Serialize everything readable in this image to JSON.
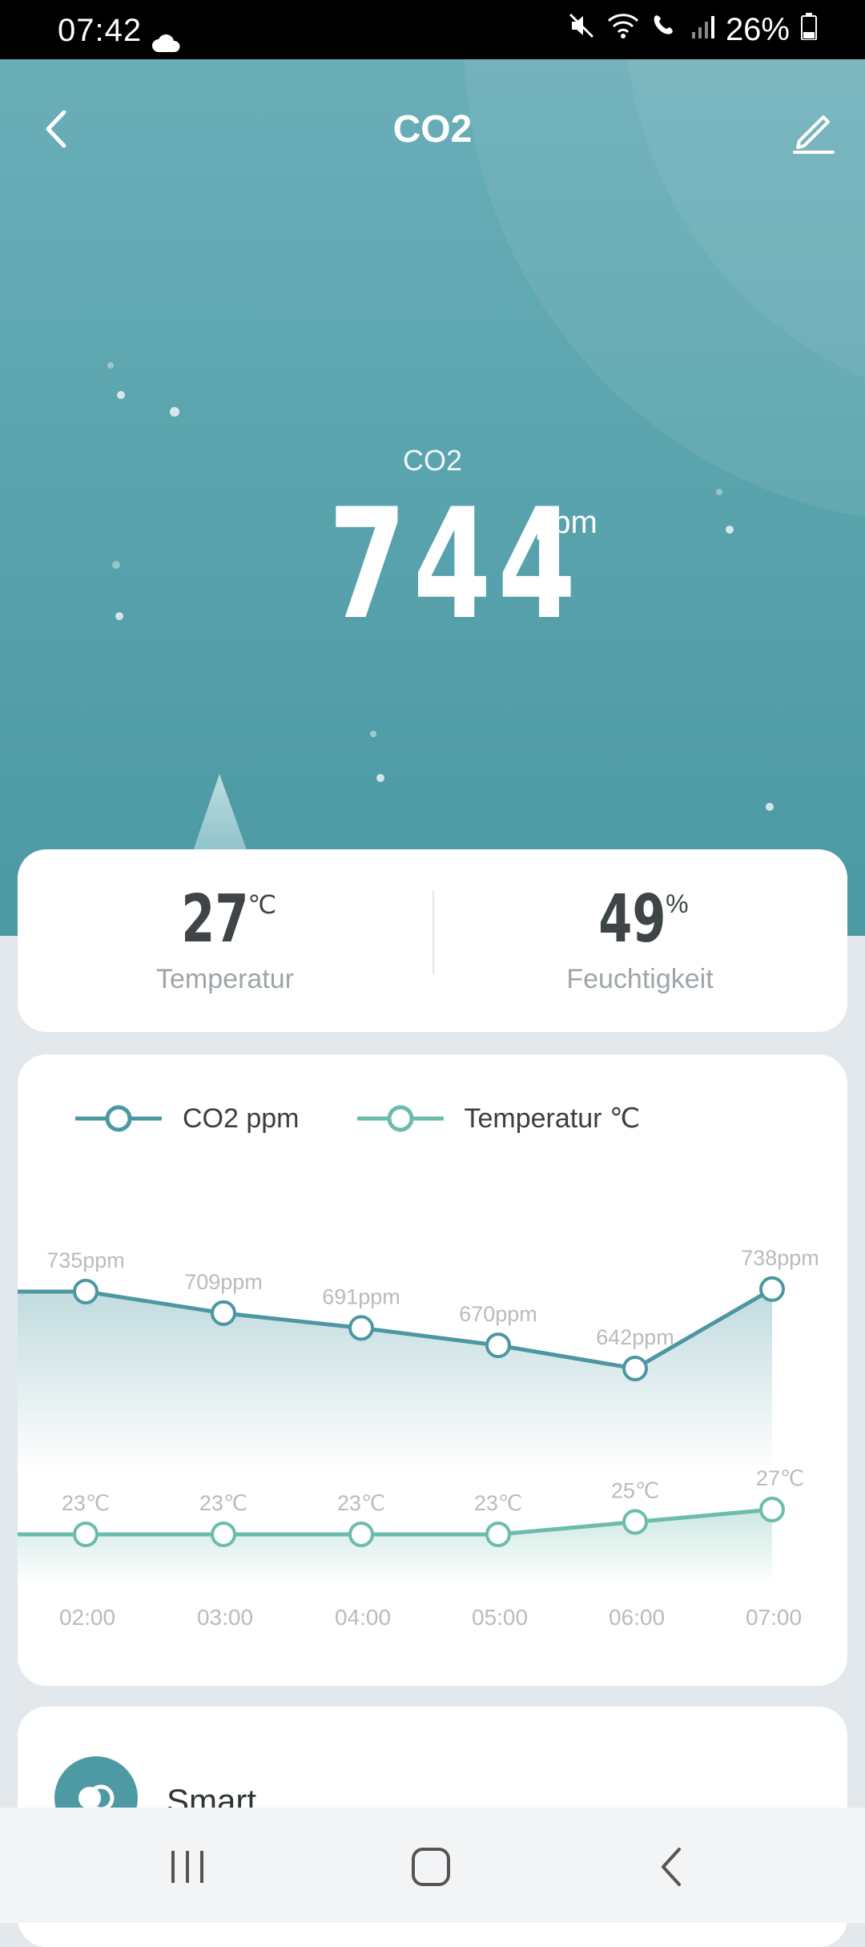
{
  "status_bar": {
    "time": "07:42",
    "battery": "26%"
  },
  "header": {
    "title": "CO2"
  },
  "hero": {
    "label": "CO2",
    "value": "744",
    "unit": "ppm"
  },
  "stats": [
    {
      "value": "27",
      "unit": "℃",
      "label": "Temperatur"
    },
    {
      "value": "49",
      "unit": "%",
      "label": "Feuchtigkeit"
    }
  ],
  "legend": [
    {
      "label": "CO2 ppm",
      "color": "#4c97a2"
    },
    {
      "label": "Temperatur ℃",
      "color": "#6cbcab"
    }
  ],
  "chart_data": {
    "type": "line",
    "x": [
      "02:00",
      "03:00",
      "04:00",
      "05:00",
      "06:00",
      "07:00"
    ],
    "series": [
      {
        "name": "CO2 ppm",
        "values": [
          735,
          709,
          691,
          670,
          642,
          738
        ],
        "labels": [
          "735ppm",
          "709ppm",
          "691ppm",
          "670ppm",
          "642ppm",
          "738ppm"
        ]
      },
      {
        "name": "Temperatur ℃",
        "values": [
          23,
          23,
          23,
          23,
          25,
          27
        ],
        "labels": [
          "23℃",
          "23℃",
          "23℃",
          "23℃",
          "25℃",
          "27℃"
        ]
      }
    ]
  },
  "smart": {
    "label": "Smart"
  }
}
